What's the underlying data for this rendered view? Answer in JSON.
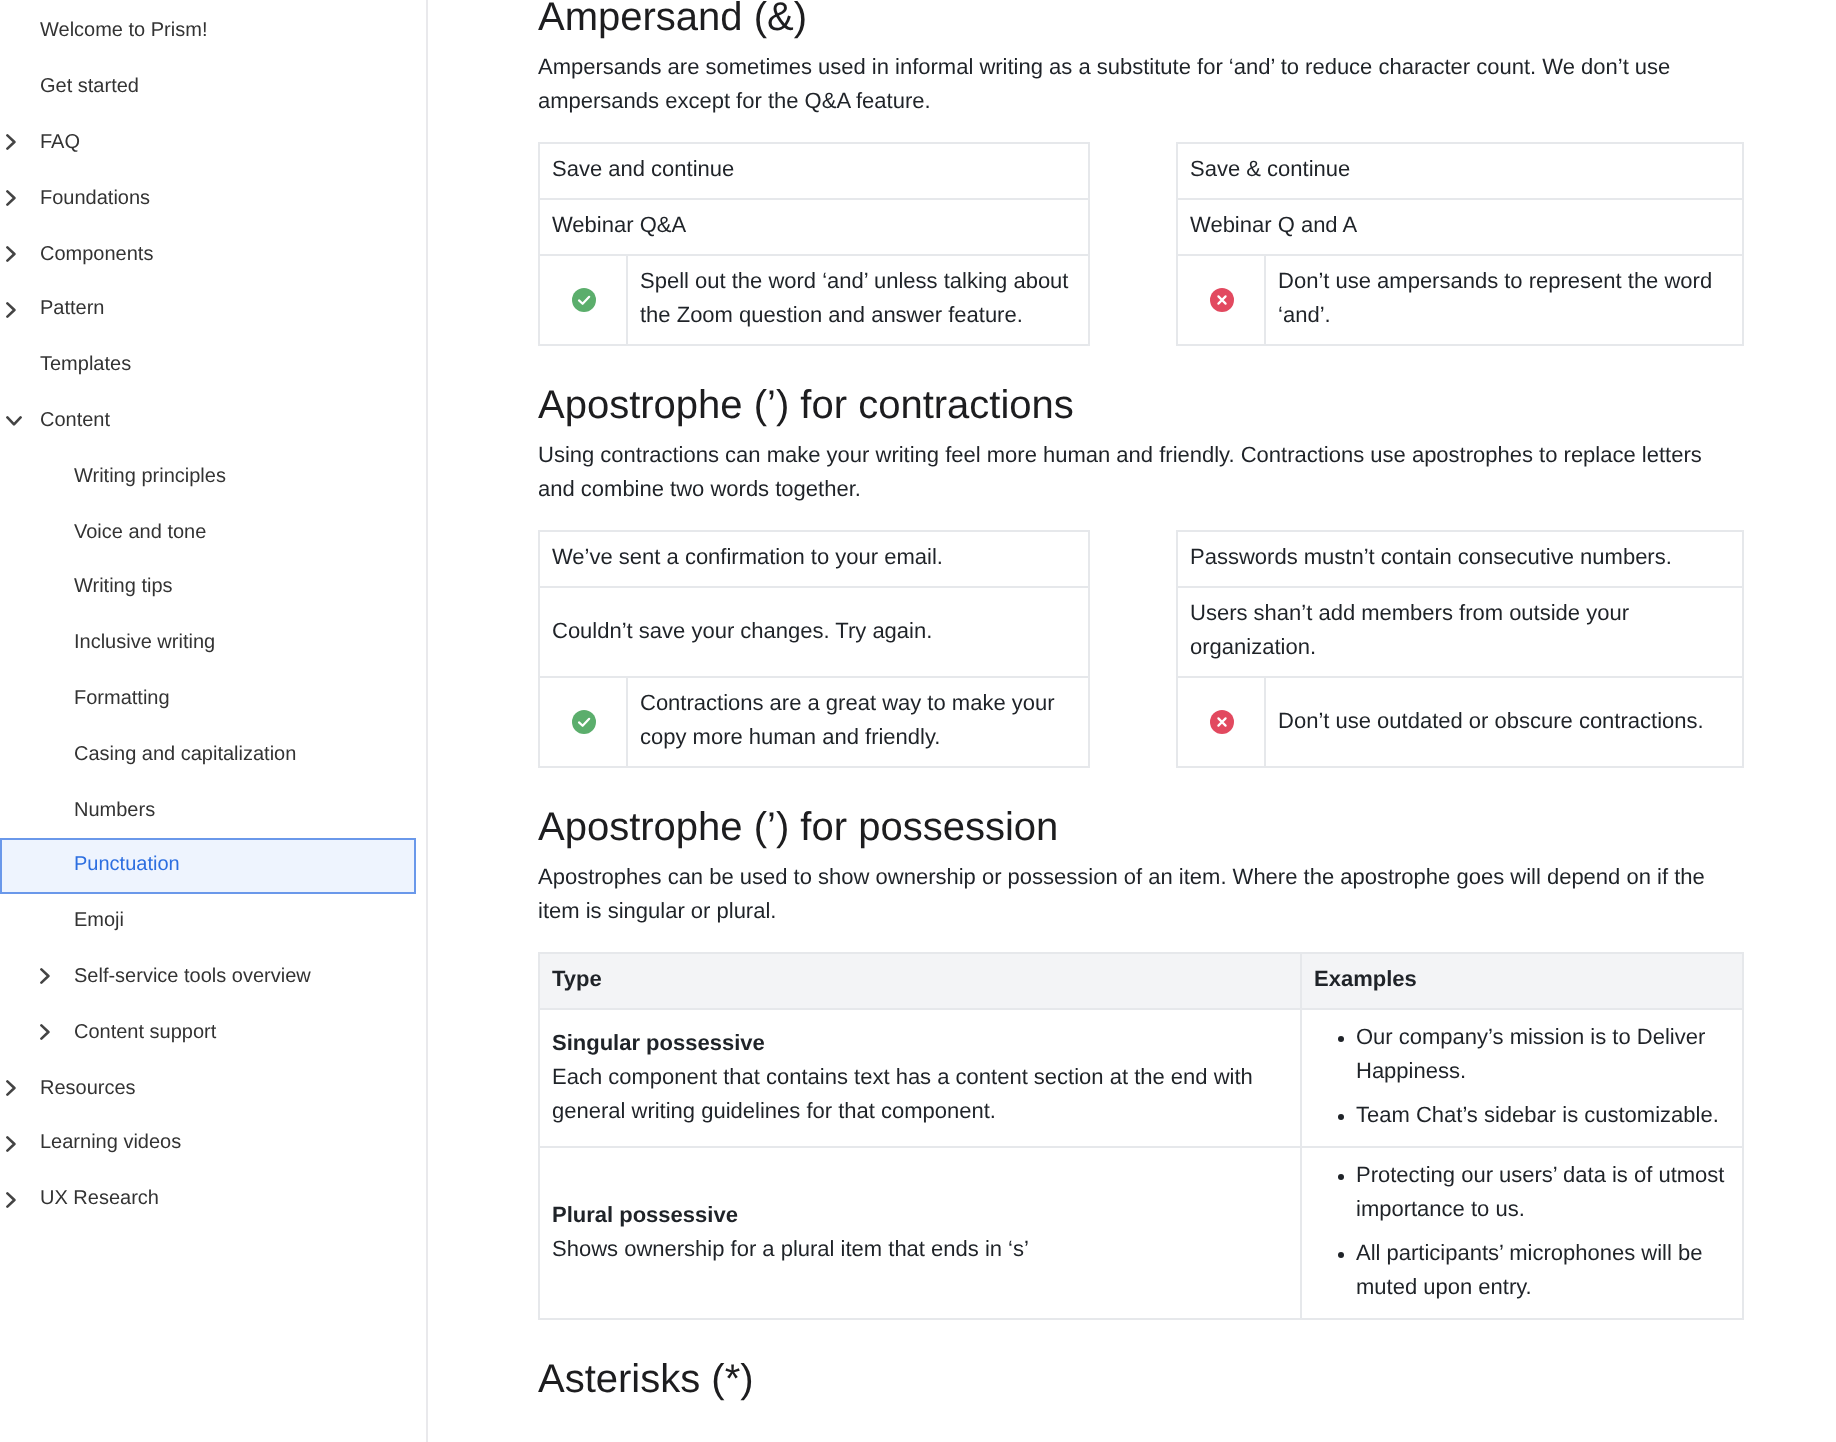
{
  "sidebar": {
    "items": [
      {
        "label": "Welcome to Prism!",
        "kind": "page",
        "selected": false
      },
      {
        "label": "Get started",
        "kind": "page",
        "selected": false
      },
      {
        "label": "FAQ",
        "kind": "folder",
        "expanded": false,
        "selected": false
      },
      {
        "label": "Foundations",
        "kind": "folder",
        "expanded": false,
        "selected": false
      },
      {
        "label": "Components",
        "kind": "folder",
        "expanded": false,
        "selected": false
      },
      {
        "label": "Pattern",
        "kind": "folder",
        "expanded": false,
        "selected": false
      },
      {
        "label": "Templates",
        "kind": "page",
        "selected": false
      },
      {
        "label": "Content",
        "kind": "folder",
        "expanded": true,
        "selected": false,
        "children": [
          {
            "label": "Writing principles",
            "kind": "page",
            "selected": false
          },
          {
            "label": "Voice and tone",
            "kind": "page",
            "selected": false
          },
          {
            "label": "Writing tips",
            "kind": "page",
            "selected": false
          },
          {
            "label": "Inclusive writing",
            "kind": "page",
            "selected": false
          },
          {
            "label": "Formatting",
            "kind": "page",
            "selected": false
          },
          {
            "label": "Casing and capitalization",
            "kind": "page",
            "selected": false
          },
          {
            "label": "Numbers",
            "kind": "page",
            "selected": false
          },
          {
            "label": "Punctuation",
            "kind": "page",
            "selected": true
          },
          {
            "label": "Emoji",
            "kind": "page",
            "selected": false
          },
          {
            "label": "Self-service tools overview",
            "kind": "folder",
            "expanded": false,
            "selected": false
          },
          {
            "label": "Content support",
            "kind": "folder",
            "expanded": false,
            "selected": false
          }
        ]
      },
      {
        "label": "Resources",
        "kind": "folder",
        "expanded": false,
        "selected": false
      },
      {
        "label": "Learning videos",
        "kind": "folder",
        "expanded": false,
        "selected": false
      },
      {
        "label": "UX Research",
        "kind": "folder",
        "expanded": false,
        "selected": false
      }
    ]
  },
  "sections": [
    {
      "kind": "comparison",
      "heading": "Ampersand (&)",
      "intro": "Ampersands are sometimes used in informal writing as a substitute for ‘and’ to reduce character count. We don’t use ampersands except for the Q&A feature.",
      "columns": [
        {
          "kind": "do",
          "examples": [
            "Save and continue",
            "Webinar Q&A"
          ],
          "note": "Spell out the word ‘and’ unless talking about the Zoom question and answer feature."
        },
        {
          "kind": "dont",
          "examples": [
            "Save & continue",
            "Webinar Q and A"
          ],
          "note": "Don’t use ampersands to represent the word ‘and’."
        }
      ]
    },
    {
      "kind": "comparison",
      "heading": "Apostrophe (’) for contractions",
      "intro": "Using contractions can make your writing feel more human and friendly. Contractions use apostrophes to replace letters and combine two words together.",
      "columns": [
        {
          "kind": "do",
          "examples": [
            "We’ve sent a confirmation to your email.",
            "Couldn’t save your changes. Try again."
          ],
          "note": "Contractions are a great way to make your copy more human and friendly."
        },
        {
          "kind": "dont",
          "examples": [
            "Passwords mustn’t contain consecutive numbers.",
            "Users shan’t add members from outside your organization."
          ],
          "note": "Don’t use outdated or obscure contractions."
        }
      ]
    },
    {
      "kind": "table",
      "heading": "Apostrophe (’) for possession",
      "intro": "Apostrophes can be used to show ownership or possession of an item. Where the apostrophe goes will depend on if the item is singular or plural.",
      "columns": [
        "Type",
        "Examples"
      ],
      "rows": [
        {
          "type": "Singular possessive",
          "description": "Each component that contains text has a content section at the end with general writing guidelines for that component.",
          "examples": [
            "Our company’s mission is to Deliver Happiness.",
            "Team Chat’s sidebar is customizable."
          ]
        },
        {
          "type": "Plural possessive",
          "description": "Shows ownership for a plural item that ends in ‘s’",
          "examples": [
            "Protecting our users’ data is of utmost importance to us.",
            "All participants’ microphones will be muted upon entry."
          ]
        }
      ]
    },
    {
      "kind": "heading",
      "heading": "Asterisks (*)"
    }
  ]
}
